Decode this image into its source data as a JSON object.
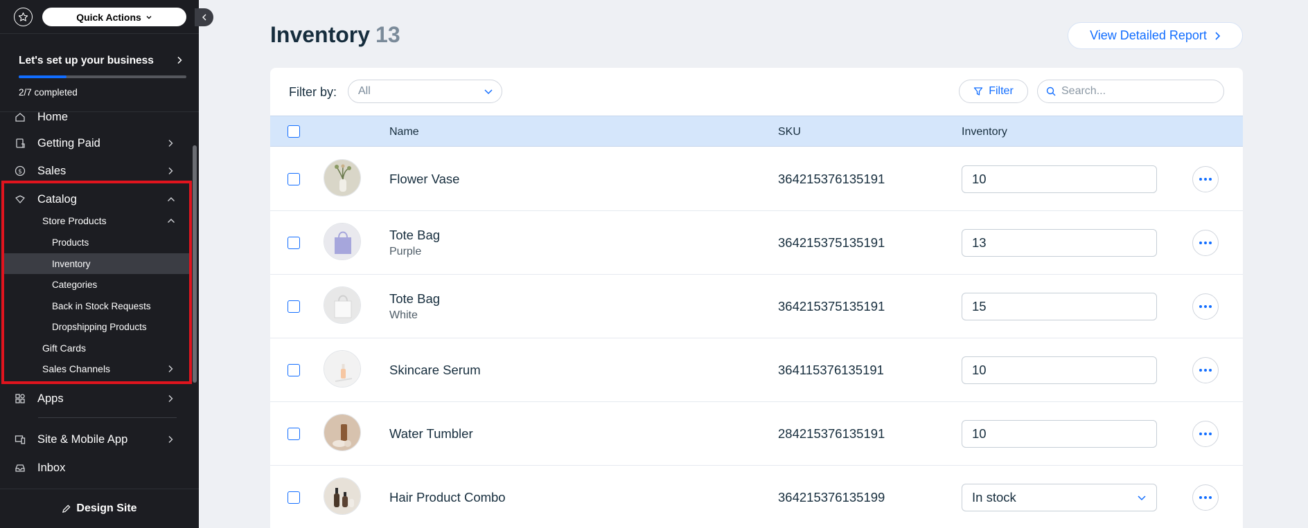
{
  "sidebar": {
    "quick_actions_label": "Quick Actions",
    "setup": {
      "title": "Let's set up your business",
      "status": "2/7 completed",
      "progress_fraction": 0.2857
    },
    "nav": {
      "home": "Home",
      "getting_paid": "Getting Paid",
      "sales": "Sales",
      "catalog": "Catalog",
      "store_products": "Store Products",
      "products": "Products",
      "inventory": "Inventory",
      "categories": "Categories",
      "back_in_stock": "Back in Stock Requests",
      "dropshipping": "Dropshipping Products",
      "gift_cards": "Gift Cards",
      "sales_channels": "Sales Channels",
      "apps": "Apps",
      "site_mobile": "Site & Mobile App",
      "inbox": "Inbox"
    },
    "design_site_label": "Design Site"
  },
  "header": {
    "title": "Inventory",
    "count": "13",
    "report_label": "View Detailed Report"
  },
  "toolbar": {
    "filter_by_label": "Filter by:",
    "filter_value": "All",
    "filter_button": "Filter",
    "search_placeholder": "Search..."
  },
  "table": {
    "columns": {
      "name": "Name",
      "sku": "SKU",
      "inventory": "Inventory"
    },
    "rows": [
      {
        "name": "Flower Vase",
        "variant": "",
        "sku": "364215376135191",
        "inventory": "10",
        "type": "input",
        "thumb": "vase"
      },
      {
        "name": "Tote Bag",
        "variant": "Purple",
        "sku": "364215375135191",
        "inventory": "13",
        "type": "input",
        "thumb": "bag-purple"
      },
      {
        "name": "Tote Bag",
        "variant": "White",
        "sku": "364215375135191",
        "inventory": "15",
        "type": "input",
        "thumb": "bag-white"
      },
      {
        "name": "Skincare Serum",
        "variant": "",
        "sku": "364115376135191",
        "inventory": "10",
        "type": "input",
        "thumb": "serum"
      },
      {
        "name": "Water Tumbler",
        "variant": "",
        "sku": "284215376135191",
        "inventory": "10",
        "type": "input",
        "thumb": "tumbler"
      },
      {
        "name": "Hair Product Combo",
        "variant": "",
        "sku": "364215376135199",
        "inventory": "In stock",
        "type": "select",
        "thumb": "hair"
      }
    ]
  },
  "colors": {
    "accent": "#116dff",
    "sidebar_bg": "#1c1d22",
    "header_row_bg": "#d5e6fb",
    "highlight_border": "#e0141e"
  }
}
